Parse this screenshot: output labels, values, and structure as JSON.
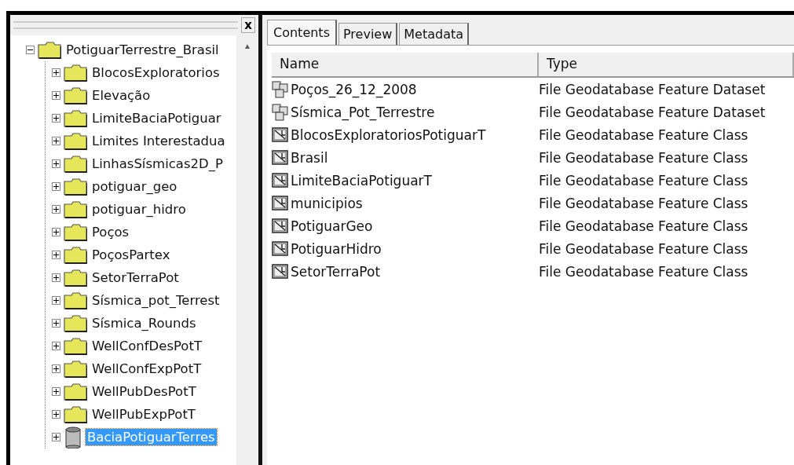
{
  "tree": {
    "close_button": "x",
    "scroll_up": "▲",
    "root": {
      "label": "PotiguarTerrestre_Brasil",
      "kind": "folder",
      "expanded": true,
      "selected": false,
      "children": [
        {
          "label": "BlocosExploratorios",
          "kind": "folder",
          "expanded": false,
          "selected": false
        },
        {
          "label": "Elevação",
          "kind": "folder",
          "expanded": false,
          "selected": false
        },
        {
          "label": "LimiteBaciaPotiguar",
          "kind": "folder",
          "expanded": false,
          "selected": false
        },
        {
          "label": "Limites Interestadua",
          "kind": "folder",
          "expanded": false,
          "selected": false
        },
        {
          "label": "LinhasSísmicas2D_P",
          "kind": "folder",
          "expanded": false,
          "selected": false
        },
        {
          "label": "potiguar_geo",
          "kind": "folder",
          "expanded": false,
          "selected": false
        },
        {
          "label": "potiguar_hidro",
          "kind": "folder",
          "expanded": false,
          "selected": false
        },
        {
          "label": "Poços",
          "kind": "folder",
          "expanded": false,
          "selected": false
        },
        {
          "label": "PoçosPartex",
          "kind": "folder",
          "expanded": false,
          "selected": false
        },
        {
          "label": "SetorTerraPot",
          "kind": "folder",
          "expanded": false,
          "selected": false
        },
        {
          "label": "Sísmica_pot_Terrest",
          "kind": "folder",
          "expanded": false,
          "selected": false
        },
        {
          "label": "Sísmica_Rounds",
          "kind": "folder",
          "expanded": false,
          "selected": false
        },
        {
          "label": "WellConfDesPotT",
          "kind": "folder",
          "expanded": false,
          "selected": false
        },
        {
          "label": "WellConfExpPotT",
          "kind": "folder",
          "expanded": false,
          "selected": false
        },
        {
          "label": "WellPubDesPotT",
          "kind": "folder",
          "expanded": false,
          "selected": false
        },
        {
          "label": "WellPubExpPotT",
          "kind": "folder",
          "expanded": false,
          "selected": false
        },
        {
          "label": "BaciaPotiguarTerres",
          "kind": "database",
          "expanded": false,
          "selected": true
        }
      ]
    }
  },
  "tabs": [
    {
      "label": "Contents",
      "selected": true
    },
    {
      "label": "Preview",
      "selected": false
    },
    {
      "label": "Metadata",
      "selected": false
    }
  ],
  "table": {
    "columns": [
      "Name",
      "Type"
    ],
    "rows": [
      {
        "kind": "dataset",
        "name": "Poços_26_12_2008",
        "type": "File Geodatabase Feature Dataset"
      },
      {
        "kind": "dataset",
        "name": "Sísmica_Pot_Terrestre",
        "type": "File Geodatabase Feature Dataset"
      },
      {
        "kind": "class",
        "name": "BlocosExploratoriosPotiguarT",
        "type": "File Geodatabase Feature Class"
      },
      {
        "kind": "class",
        "name": "Brasil",
        "type": "File Geodatabase Feature Class"
      },
      {
        "kind": "class",
        "name": "LimiteBaciaPotiguarT",
        "type": "File Geodatabase Feature Class"
      },
      {
        "kind": "class",
        "name": "municipios",
        "type": "File Geodatabase Feature Class"
      },
      {
        "kind": "class",
        "name": "PotiguarGeo",
        "type": "File Geodatabase Feature Class"
      },
      {
        "kind": "class",
        "name": "PotiguarHidro",
        "type": "File Geodatabase Feature Class"
      },
      {
        "kind": "class",
        "name": "SetorTerraPot",
        "type": "File Geodatabase Feature Class"
      }
    ]
  }
}
